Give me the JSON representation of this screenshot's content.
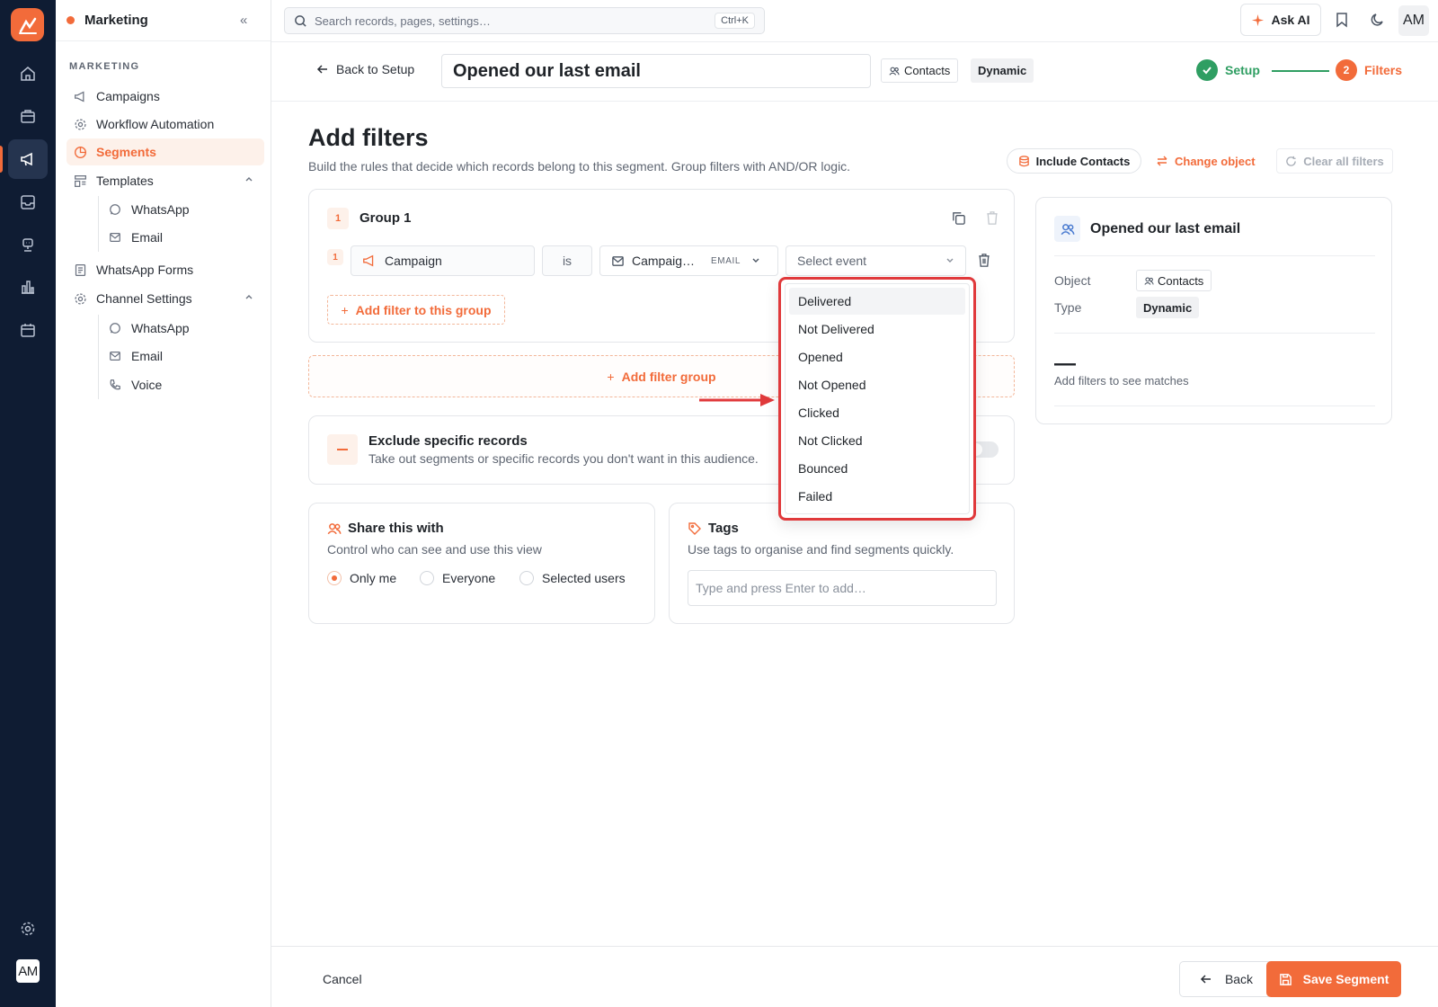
{
  "colors": {
    "accent": "#f26b3a",
    "success": "#2f9e62",
    "rail_bg": "#0f1c33",
    "highlight": "#e0393b"
  },
  "rail": {
    "logo_icon": "app-logo-icon",
    "icons": [
      "home-icon",
      "briefcase-icon",
      "megaphone-icon",
      "inbox-icon",
      "bot-icon",
      "chart-icon",
      "calendar-icon"
    ],
    "settings_icon": "gear-icon",
    "avatar": "AM"
  },
  "sidebar": {
    "workspace": "Marketing",
    "section_label": "MARKETING",
    "items": [
      {
        "label": "Campaigns",
        "icon": "megaphone-icon"
      },
      {
        "label": "Workflow Automation",
        "icon": "cog-icon"
      },
      {
        "label": "Segments",
        "icon": "pie-icon",
        "active": true
      },
      {
        "label": "Templates",
        "icon": "template-icon",
        "expanded": true
      },
      {
        "label": "WhatsApp Forms",
        "icon": "form-icon"
      },
      {
        "label": "Channel Settings",
        "icon": "cog-icon",
        "expanded": true
      }
    ],
    "templates_children": [
      {
        "label": "WhatsApp",
        "icon": "whatsapp-icon"
      },
      {
        "label": "Email",
        "icon": "mail-icon"
      }
    ],
    "channel_children": [
      {
        "label": "WhatsApp",
        "icon": "whatsapp-icon"
      },
      {
        "label": "Email",
        "icon": "mail-icon"
      },
      {
        "label": "Voice",
        "icon": "phone-icon"
      }
    ]
  },
  "topbar": {
    "search_placeholder": "Search records, pages, settings…",
    "shortcut": "Ctrl+K",
    "ask_ai": "Ask AI",
    "avatar": "AM"
  },
  "header": {
    "back_label": "Back to Setup",
    "segment_name": "Opened our last email",
    "object_chip": "Contacts",
    "type_chip": "Dynamic",
    "steps": [
      {
        "label": "Setup",
        "state": "complete"
      },
      {
        "label": "Filters",
        "number": "2",
        "state": "current"
      }
    ]
  },
  "main": {
    "title": "Add filters",
    "subtitle": "Build the rules that decide which records belong to this segment. Group filters with AND/OR logic.",
    "toolbar": {
      "include": "Include Contacts",
      "change_object": "Change object",
      "clear_all": "Clear all filters"
    },
    "group": {
      "number": "1",
      "title": "Group 1",
      "filter": {
        "number": "1",
        "field": "Campaign",
        "operator": "is",
        "value": "Campaig…",
        "value_tag": "EMAIL",
        "event_placeholder": "Select event"
      },
      "add_filter": "Add filter to this group"
    },
    "add_group": "Add filter group",
    "exclude": {
      "title": "Exclude specific records",
      "subtitle": "Take out segments or specific records you don't want in this audience.",
      "enabled": false
    },
    "share": {
      "title": "Share this with",
      "subtitle": "Control who can see and use this view",
      "options": [
        "Only me",
        "Everyone",
        "Selected users"
      ],
      "selected": "Only me"
    },
    "tags": {
      "title": "Tags",
      "subtitle": "Use tags to organise and find segments quickly.",
      "placeholder": "Type and press Enter to add…"
    }
  },
  "event_dropdown": {
    "options": [
      "Delivered",
      "Not Delivered",
      "Opened",
      "Not Opened",
      "Clicked",
      "Not Clicked",
      "Bounced",
      "Failed"
    ],
    "hovered": "Delivered"
  },
  "summary": {
    "title": "Opened our last email",
    "object_label": "Object",
    "object_value": "Contacts",
    "type_label": "Type",
    "type_value": "Dynamic",
    "count": "—",
    "hint": "Add filters to see matches"
  },
  "footer": {
    "cancel": "Cancel",
    "back": "Back",
    "save": "Save Segment"
  }
}
